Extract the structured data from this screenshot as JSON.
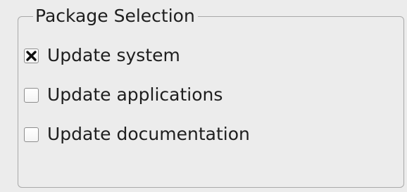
{
  "group": {
    "title": "Package Selection"
  },
  "options": [
    {
      "label": "Update system",
      "checked": true
    },
    {
      "label": "Update applications",
      "checked": false
    },
    {
      "label": "Update documentation",
      "checked": false
    }
  ]
}
